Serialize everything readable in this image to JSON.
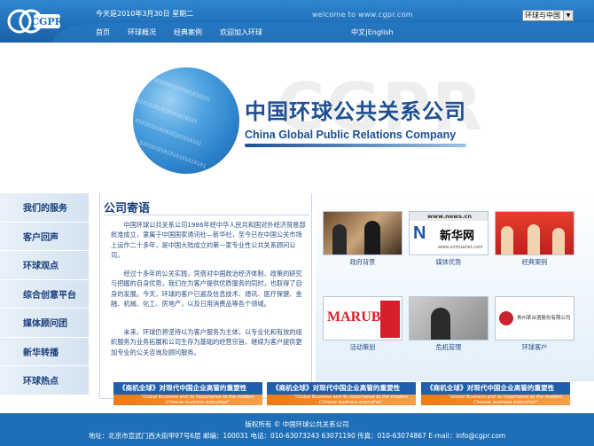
{
  "header": {
    "date": "今天是2010年3月30日 星期二",
    "welcome": "welcome to www.cgpr.com",
    "select_value": "环球与中国",
    "logo_text": "CGPR",
    "nav": [
      "首页",
      "环球概况",
      "经典案例",
      "欢迎加入环球"
    ],
    "lang": "中文|English"
  },
  "banner": {
    "title_cn": "中国环球公共关系公司",
    "title_en": "China Global Public Relations Company",
    "watermark": "CGPR",
    "binary_text": "0101010101010101010101"
  },
  "sidebar": {
    "items": [
      "我们的服务",
      "客户回声",
      "环球观点",
      "综合创意平台",
      "媒体顾问团",
      "新华转播",
      "环球热点"
    ]
  },
  "content": {
    "title": "公司寄语",
    "paragraphs": [
      "中国环球公共关系公司1986年经中华人民共和国对外经济贸易部批准成立，隶属于中国国家通讯社—新华社，至今已在中国公关市场上运作二十多年，是中国大陆成立的第一家专业性公共关系顾问公司。",
      "经过十多年的公关实践，凭借对中国政治经济体制、政策的研究与把握的自身优势，我们在为客户提供优质服务的同时，也取得了自身的发展。今天，环球的客户已遍及信息技术、通讯、医疗保健、金融、机械、化工、房地产，以及日用消费品等各个领域。",
      "未来，环球仍将坚持以为客户服务为主体，以专业化和有效的组织服务为业务拓展和公司生存为基础的经营宗旨，继续为客户提供更加专业的公关咨询及顾问服务。"
    ]
  },
  "thumbs": [
    {
      "caption": "政府背景"
    },
    {
      "caption": "媒体优势",
      "logo_text": "新华网",
      "logo_sub": "www.xinhuanet.com",
      "news_top": "www.news.cn"
    },
    {
      "caption": "经典案例"
    },
    {
      "caption": "活动策划",
      "logo_text": "MARUBI"
    },
    {
      "caption": "危机管理"
    },
    {
      "caption": "环球客户",
      "logo_text": "贵州茅台酒股份有限公司"
    }
  ],
  "promos": [
    {
      "title": "《商机全球》对现代中国企业高管的重要性",
      "sub": "\"Global Business and its Importance to the modern Chinese business executive\""
    },
    {
      "title": "《商机全球》对现代中国企业高管的重要性",
      "sub": "\"Global Business and its Importance to the modern Chinese business executive\""
    },
    {
      "title": "《商机全球》对现代中国企业高管的重要性",
      "sub": "\"Global Business and its Importance to the modern Chinese business executive\""
    }
  ],
  "footer": {
    "copyright": "版权所有 © 中国环球公共关系公司",
    "address": "地址：北京市宣武门西大街甲97号6层 邮编：100031 电话：010-63073243 63071190 传真：010-63074867 E-mail：info@cgpr.com"
  },
  "colors": {
    "primary": "#1f6fb8",
    "title_blue": "#1d4f93",
    "orange": "#f07a16"
  }
}
